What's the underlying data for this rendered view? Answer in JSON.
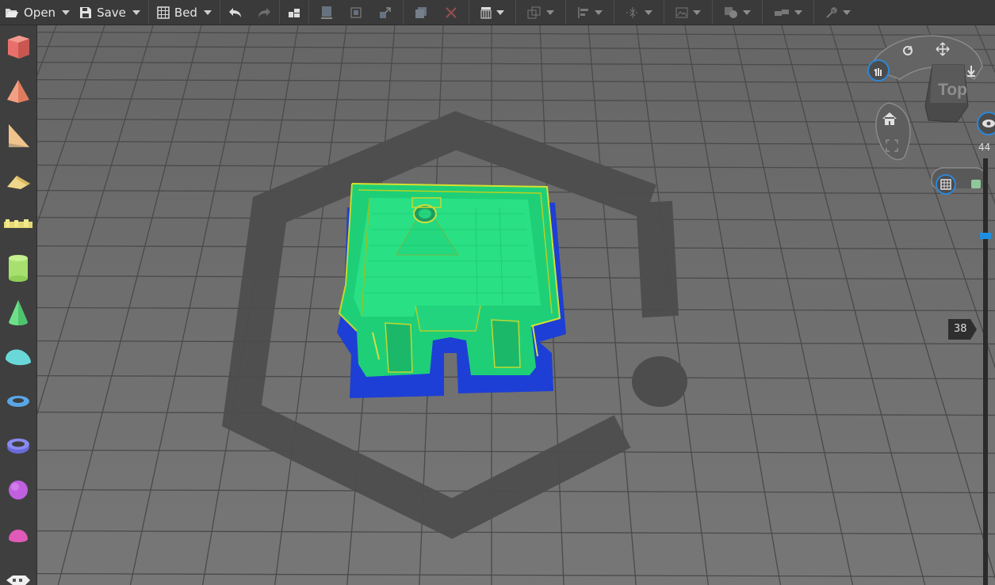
{
  "toolbar": {
    "open_label": "Open",
    "save_label": "Save",
    "bed_label": "Bed"
  },
  "navigator": {
    "view_label": "Top"
  },
  "layer_slider": {
    "max_layer": "44",
    "current_layer": "38",
    "thumb_color": "#1e8fe0"
  },
  "colors": {
    "toolbar_bg": "#3a3a3a",
    "viewport_bg": "#707070",
    "model_green": "#1fd27a",
    "model_blue": "#1d3fd6",
    "accent_blue": "#1e8fe0"
  },
  "sidebar_shapes": [
    "cube-icon",
    "pyramid-icon",
    "wedge-icon",
    "prism-icon",
    "text-icon",
    "cylinder-icon",
    "cone-icon",
    "torus-half-icon",
    "ring-icon",
    "tube-icon",
    "sphere-icon",
    "hemisphere-icon",
    "text-3d-icon"
  ]
}
